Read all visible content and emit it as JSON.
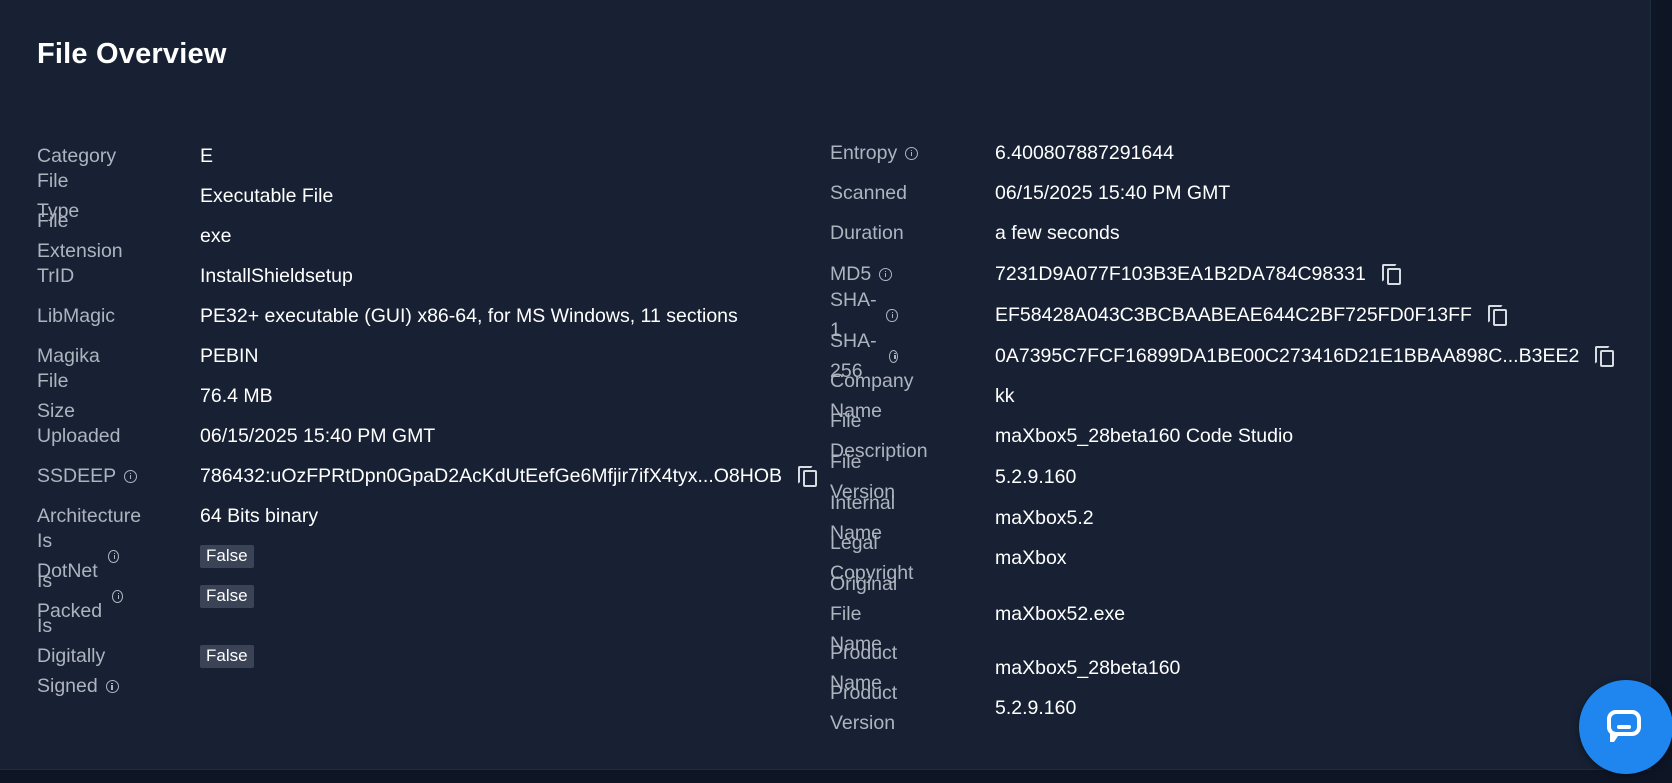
{
  "title": "File Overview",
  "left": {
    "category": {
      "label": "Category",
      "value": "E"
    },
    "file_type": {
      "label": "File Type",
      "value": "Executable File"
    },
    "file_extension": {
      "label": "File Extension",
      "value": "exe"
    },
    "trid": {
      "label": "TrID",
      "value": "InstallShieldsetup"
    },
    "libmagic": {
      "label": "LibMagic",
      "value": "PE32+ executable (GUI) x86-64, for MS Windows, 11 sections"
    },
    "magika": {
      "label": "Magika",
      "value": "PEBIN"
    },
    "file_size": {
      "label": "File Size",
      "value": "76.4 MB"
    },
    "uploaded": {
      "label": "Uploaded",
      "value": "06/15/2025 15:40 PM GMT"
    },
    "ssdeep": {
      "label": "SSDEEP",
      "value": "786432:uOzFPRtDpn0GpaD2AcKdUtEefGe6Mfjir7ifX4tyx...O8HOB"
    },
    "architecture": {
      "label": "Architecture",
      "value": "64 Bits binary"
    },
    "is_dotnet": {
      "label": "Is DotNet",
      "value": "False"
    },
    "is_packed": {
      "label": "Is Packed",
      "value": "False"
    },
    "is_signed": {
      "label_line1": "Is Digitally",
      "label_line2": "Signed",
      "value": "False"
    }
  },
  "right": {
    "entropy": {
      "label": "Entropy",
      "value": "6.400807887291644"
    },
    "scanned": {
      "label": "Scanned",
      "value": "06/15/2025 15:40 PM GMT"
    },
    "duration": {
      "label": "Duration",
      "value": "a few seconds"
    },
    "md5": {
      "label": "MD5",
      "value": "7231D9A077F103B3EA1B2DA784C98331"
    },
    "sha1": {
      "label": "SHA-1",
      "value": "EF58428A043C3BCBAABEAE644C2BF725FD0F13FF"
    },
    "sha256": {
      "label": "SHA-256",
      "value": "0A7395C7FCF16899DA1BE00C273416D21E1BBAA898C...B3EE2"
    },
    "company_name": {
      "label": "Company Name",
      "value": "kk"
    },
    "file_description": {
      "label": "File Description",
      "value": "maXbox5_28beta160 Code Studio"
    },
    "file_version": {
      "label": "File Version",
      "value": "5.2.9.160"
    },
    "internal_name": {
      "label": "Internal Name",
      "value": "maXbox5.2"
    },
    "legal_copyright": {
      "label": "Legal Copyright",
      "value": "maXbox"
    },
    "original_file_name": {
      "label_line1": "Original File",
      "label_line2": "Name",
      "value": "maXbox52.exe"
    },
    "product_name": {
      "label": "Product Name",
      "value": "maXbox5_28beta160"
    },
    "product_version": {
      "label": "Product Version",
      "value": "5.2.9.160"
    }
  },
  "icons": {
    "info": "info-icon",
    "copy": "copy-icon",
    "chat": "chat-icon"
  },
  "colors": {
    "page_bg": "#0e1626",
    "panel_bg": "#172133",
    "label": "#aeb4bf",
    "value": "#ffffff",
    "badge_bg": "#3a4456",
    "chat_button": "#1f86f0"
  }
}
